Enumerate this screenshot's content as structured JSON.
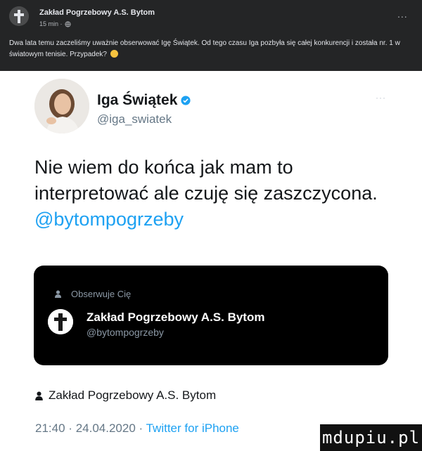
{
  "facebook_post": {
    "page_name": "Zakład Pogrzebowy A.S. Bytom",
    "time": "15 min ·",
    "more": "...",
    "text": "Dwa lata temu zaczeliśmy uważnie obserwować Igę Świątek. Od tego czasu Iga pozbyła się całej konkurencji i została nr. 1 w światowym tenisie. Przypadek?",
    "icons": {
      "privacy": "globe-icon",
      "emoji": "grinning-face-emoji"
    }
  },
  "tweet": {
    "author_name": "Iga Świątek",
    "author_handle": "@iga_swiatek",
    "more": "···",
    "text": "Nie wiem do końca jak mam to interpretować ale czuję się zaszczycona. ",
    "mention": "@bytompogrzeby",
    "colors": {
      "link": "#1da1f2",
      "text": "#14171a",
      "muted": "#657786"
    },
    "icons": {
      "verified": "verified-badge-icon"
    }
  },
  "quoted_profile": {
    "follows_you": "Obserwuje Cię",
    "name": "Zakład Pogrzebowy A.S. Bytom",
    "handle": "@bytompogrzeby",
    "icons": {
      "person": "person-icon"
    }
  },
  "footer": {
    "retweeted_by": "Zakład Pogrzebowy A.S. Bytom",
    "time": "21:40",
    "date": "24.04.2020",
    "separator": "·",
    "source": "Twitter for iPhone",
    "icons": {
      "person": "person-icon"
    }
  },
  "watermark": {
    "text": "mdupiu.pl"
  }
}
